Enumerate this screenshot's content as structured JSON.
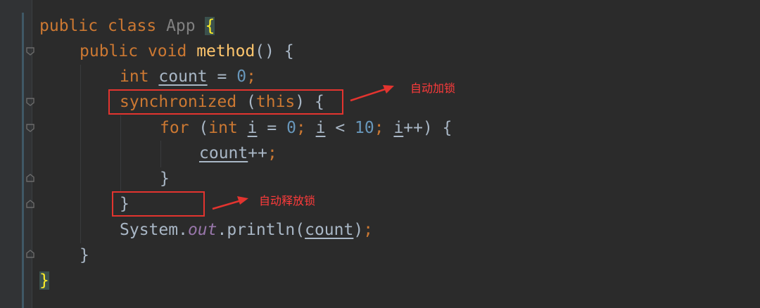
{
  "code": {
    "line1": {
      "kw1": "public",
      "kw2": "class",
      "class_name": "App",
      "brace": "{"
    },
    "line2": {
      "kw1": "public",
      "kw2": "void",
      "method": "method",
      "rest": "() {"
    },
    "line3": {
      "type": "int",
      "var": "count",
      "op": " = ",
      "num": "0",
      "semi": ";"
    },
    "line4": {
      "kw": "synchronized",
      "rest": " (",
      "this": "this",
      "rest2": ") {"
    },
    "line5": {
      "kw": "for",
      "p1": " (",
      "type": "int",
      "sp": " ",
      "i1": "i",
      "op1": " = ",
      "n1": "0",
      "semi1": "; ",
      "i2": "i",
      "op2": " < ",
      "n2": "10",
      "semi2": "; ",
      "i3": "i",
      "inc": "++) {"
    },
    "line6": {
      "var": "count",
      "inc": "++",
      "semi": ";"
    },
    "line7": {
      "brace": "}"
    },
    "line8": {
      "brace": "}"
    },
    "line9": {
      "cls": "System.",
      "field": "out",
      "call": ".println(",
      "arg": "count",
      "close": ")",
      "semi": ";"
    },
    "line10": {
      "brace": "}"
    },
    "line11": {
      "brace": "}"
    }
  },
  "annotations": {
    "lock": "自动加锁",
    "unlock": "自动释放锁"
  },
  "colors": {
    "background": "#2b2b2b",
    "keyword": "#cc7832",
    "method": "#ffc66d",
    "number": "#6897bb",
    "annotation": "#e3342f"
  }
}
